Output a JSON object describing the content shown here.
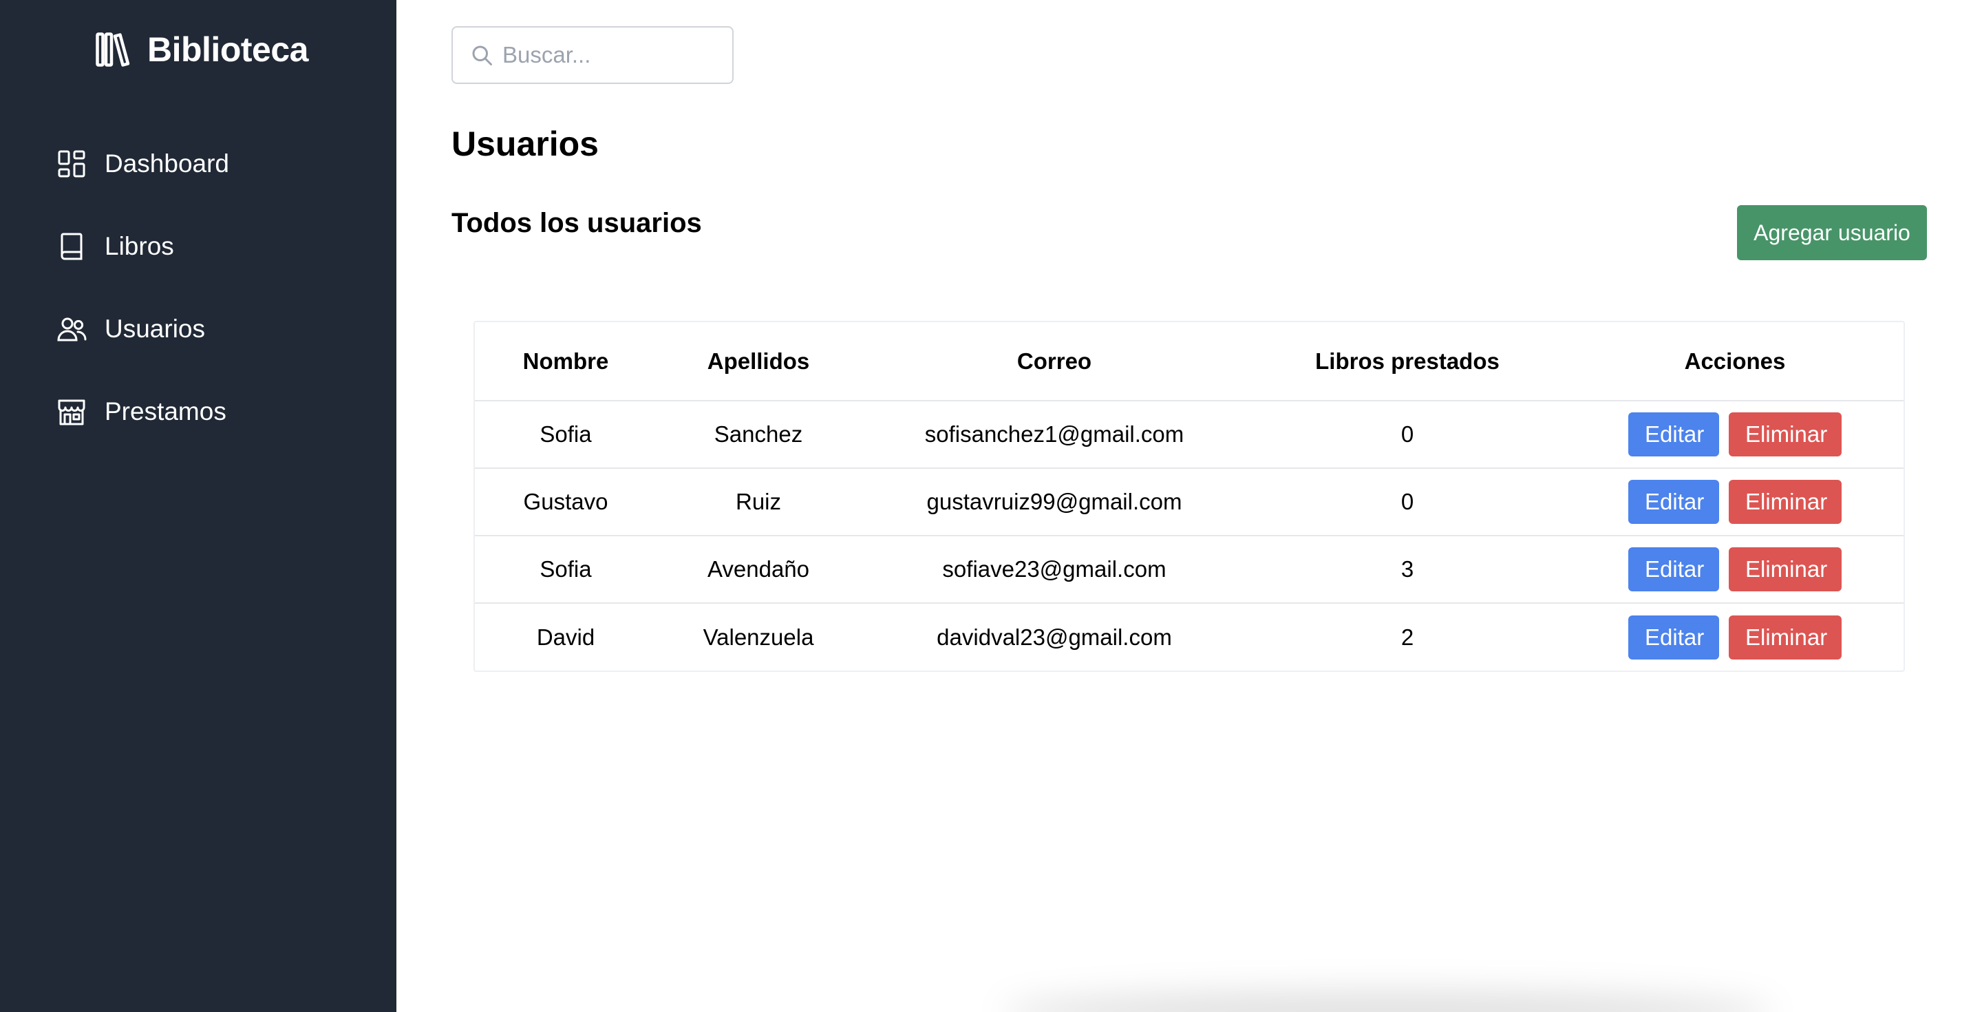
{
  "brand": {
    "title": "Biblioteca",
    "icon": "library-books-icon"
  },
  "sidebar": {
    "items": [
      {
        "label": "Dashboard",
        "icon": "dashboard-grid-icon"
      },
      {
        "label": "Libros",
        "icon": "book-icon"
      },
      {
        "label": "Usuarios",
        "icon": "users-icon"
      },
      {
        "label": "Prestamos",
        "icon": "store-icon"
      }
    ]
  },
  "search": {
    "placeholder": "Buscar...",
    "value": ""
  },
  "page": {
    "title": "Usuarios",
    "section_title": "Todos los usuarios",
    "add_button": "Agregar usuario"
  },
  "table": {
    "headers": {
      "nombre": "Nombre",
      "apellidos": "Apellidos",
      "correo": "Correo",
      "libros": "Libros prestados",
      "acciones": "Acciones"
    },
    "rows": [
      {
        "nombre": "Sofia",
        "apellidos": "Sanchez",
        "correo": "sofisanchez1@gmail.com",
        "libros": "0"
      },
      {
        "nombre": "Gustavo",
        "apellidos": "Ruiz",
        "correo": "gustavruiz99@gmail.com",
        "libros": "0"
      },
      {
        "nombre": "Sofia",
        "apellidos": "Avendaño",
        "correo": "sofiave23@gmail.com",
        "libros": "3"
      },
      {
        "nombre": "David",
        "apellidos": "Valenzuela",
        "correo": "davidval23@gmail.com",
        "libros": "2"
      }
    ],
    "edit_label": "Editar",
    "delete_label": "Eliminar"
  },
  "colors": {
    "sidebar_bg": "#212936",
    "add_button": "#479468",
    "edit_button": "#4c83ec",
    "delete_button": "#dc5552"
  }
}
